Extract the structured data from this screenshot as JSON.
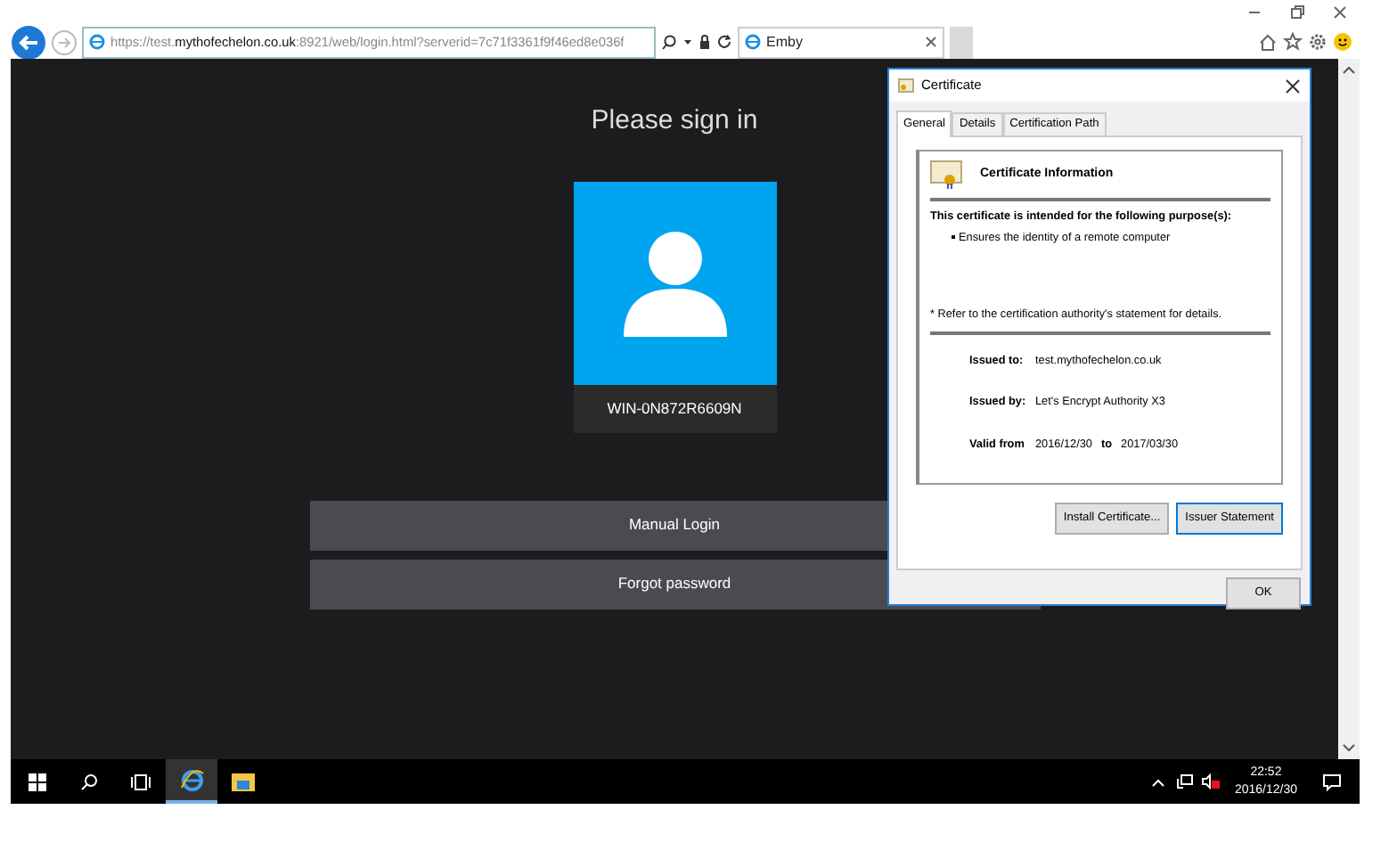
{
  "browser": {
    "url": "https://test.**mythofechelon.co.uk**:8921/web/login.html?serverid=7c71f3361f9f46ed8e036f",
    "tabs": [
      {
        "label": "Emby",
        "selected": true
      }
    ]
  },
  "page": {
    "title": "Please sign in",
    "user": {
      "name": "WIN-0N872R6609N"
    },
    "buttons": [
      "Manual Login",
      "Forgot password"
    ]
  },
  "dialog": {
    "title": "Certificate",
    "tabs": [
      {
        "label": "General",
        "selected": true
      },
      {
        "label": "Details",
        "selected": false
      },
      {
        "label": "Certification Path",
        "selected": false
      }
    ],
    "heading": "Certificate Information",
    "purpose_heading": "This certificate is intended for the following purpose(s):",
    "purposes": [
      "Ensures the identity of a remote computer"
    ],
    "note": "* Refer to the certification authority's statement for details.",
    "fields": [
      {
        "label": "Issued to:",
        "value": "test.mythofechelon.co.uk"
      },
      {
        "label": "Issued by:",
        "value": "Let's Encrypt Authority X3"
      }
    ],
    "valid": {
      "label": "Valid from",
      "from": "2016/12/30",
      "to_label": "to",
      "to": "2017/03/30"
    },
    "buttons": [
      "Install Certificate...",
      "Issuer Statement"
    ],
    "ok": "OK"
  },
  "taskbar": {
    "time": "22:52",
    "date": "2016/12/30"
  }
}
